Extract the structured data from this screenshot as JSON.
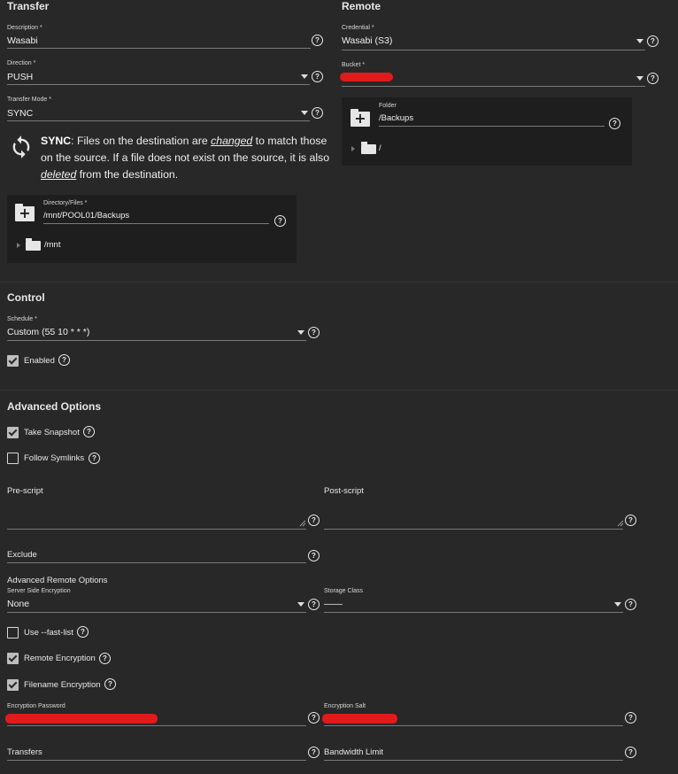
{
  "transfer": {
    "section_title": "Transfer",
    "description": {
      "label": "Description *",
      "value": "Wasabi"
    },
    "direction": {
      "label": "Direction *",
      "value": "PUSH"
    },
    "transfer_mode": {
      "label": "Transfer Mode *",
      "value": "SYNC"
    },
    "sync_info": {
      "mode": "SYNC",
      "p1": ": Files on the destination are ",
      "w1": "changed",
      "p2": " to match those on the source. If a file does not exist on the source, it is also ",
      "w2": "deleted",
      "p3": " from the destination."
    },
    "directory_files": {
      "label": "Directory/Files *",
      "value": "/mnt/POOL01/Backups",
      "tree_item": "/mnt"
    }
  },
  "remote": {
    "section_title": "Remote",
    "credential": {
      "label": "Credential *",
      "value": "Wasabi (S3)"
    },
    "bucket": {
      "label": "Bucket *",
      "value": ""
    },
    "folder": {
      "label": "Folder",
      "value": "/Backups",
      "tree_item": "/"
    }
  },
  "control": {
    "section_title": "Control",
    "schedule": {
      "label": "Schedule *",
      "value": "Custom (55 10 * * *)"
    },
    "enabled": {
      "label": "Enabled",
      "checked": true
    }
  },
  "advanced": {
    "section_title": "Advanced Options",
    "take_snapshot": {
      "label": "Take Snapshot",
      "checked": true
    },
    "follow_symlinks": {
      "label": "Follow Symlinks",
      "checked": false
    },
    "pre_script": {
      "label": "Pre-script",
      "value": ""
    },
    "post_script": {
      "label": "Post-script",
      "value": ""
    },
    "exclude": {
      "label": "Exclude",
      "value": ""
    }
  },
  "advanced_remote": {
    "section_title": "Advanced Remote Options",
    "server_side_encryption": {
      "label": "Server Side Encryption",
      "value": "None"
    },
    "storage_class": {
      "label": "Storage Class",
      "value": "——"
    },
    "fast_list": {
      "label": "Use --fast-list",
      "checked": false
    },
    "remote_encryption": {
      "label": "Remote Encryption",
      "checked": true
    },
    "filename_encryption": {
      "label": "Filename Encryption",
      "checked": true
    },
    "encryption_password": {
      "label": "Encryption Password",
      "value": ""
    },
    "encryption_salt": {
      "label": "Encryption Salt",
      "value": ""
    },
    "transfers": {
      "label": "Transfers",
      "value": ""
    },
    "bandwidth_limit": {
      "label": "Bandwidth Limit",
      "value": ""
    }
  },
  "help_glyph": "?",
  "colors": {
    "background": "#282828",
    "panel": "#1e1e1e",
    "redaction": "#e11b1b",
    "text": "#e0e0e0"
  }
}
